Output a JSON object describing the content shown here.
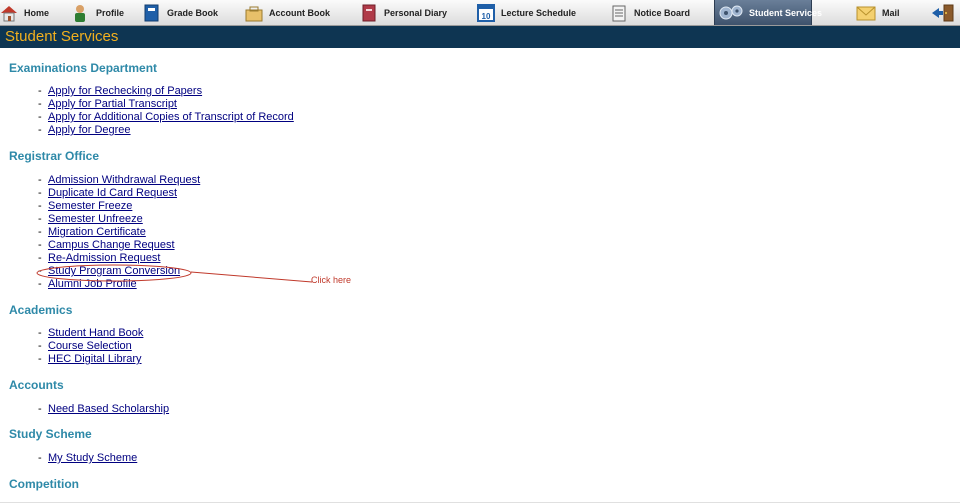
{
  "nav": {
    "items": [
      {
        "label": "Home",
        "icon": "home-icon"
      },
      {
        "label": "Profile",
        "icon": "profile-icon"
      },
      {
        "label": "Grade Book",
        "icon": "grade-book-icon"
      },
      {
        "label": "Account Book",
        "icon": "account-book-icon"
      },
      {
        "label": "Personal Diary",
        "icon": "personal-diary-icon"
      },
      {
        "label": "Lecture Schedule",
        "icon": "calendar-icon"
      },
      {
        "label": "Notice Board",
        "icon": "notice-board-icon"
      },
      {
        "label": "Student Services",
        "icon": "gears-icon"
      },
      {
        "label": "Mail",
        "icon": "mail-icon"
      },
      {
        "label": "",
        "icon": "logout-icon"
      }
    ],
    "active_color": "#4a5f7a",
    "calendar_number": "10"
  },
  "page_title": "Student Services",
  "sections": [
    {
      "title": "Examinations Department",
      "links": [
        "Apply for Rechecking of Papers",
        "Apply for Partial Transcript",
        "Apply for Additional Copies of Transcript of Record",
        "Apply for Degree"
      ]
    },
    {
      "title": "Registrar Office",
      "links": [
        "Admission Withdrawal Request",
        "Duplicate Id Card Request",
        "Semester Freeze",
        "Semester Unfreeze",
        "Migration Certificate",
        "Campus Change Request",
        "Re-Admission Request",
        "Study Program Conversion",
        "Alumni Job Profile"
      ]
    },
    {
      "title": "Academics",
      "links": [
        "Student Hand Book",
        "Course Selection",
        "HEC Digital Library"
      ]
    },
    {
      "title": "Accounts",
      "links": [
        "Need Based Scholarship"
      ]
    },
    {
      "title": "Study Scheme",
      "links": [
        "My Study Scheme"
      ]
    },
    {
      "title": "Competition",
      "links": []
    }
  ],
  "annotation": {
    "text": "Click here",
    "color": "#c0392b"
  },
  "colors": {
    "title_bar": "#0e3552",
    "title_text": "#f2b01e",
    "section_title": "#2e89a8",
    "link": "#000080"
  }
}
